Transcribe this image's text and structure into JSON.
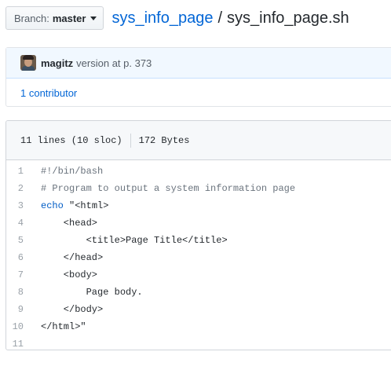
{
  "branch": {
    "prefix": "Branch:",
    "name": "master"
  },
  "breadcrumb": {
    "repo": "sys_info_page",
    "separator": "/",
    "file": "sys_info_page.sh"
  },
  "commit": {
    "author": "magitz",
    "message": "version at p. 373",
    "contributors": "1 contributor"
  },
  "file": {
    "lines_info": "11 lines (10 sloc)",
    "size": "172 Bytes"
  },
  "code_lines": [
    {
      "num": "1",
      "text": "#!/bin/bash"
    },
    {
      "num": "2",
      "text": "# Program to output a system information page"
    },
    {
      "num": "3",
      "kw": "echo",
      "text": " \"<html>"
    },
    {
      "num": "4",
      "text": "    <head>"
    },
    {
      "num": "5",
      "text": "        <title>Page Title</title>"
    },
    {
      "num": "6",
      "text": "    </head>"
    },
    {
      "num": "7",
      "text": "    <body>"
    },
    {
      "num": "8",
      "text": "        Page body."
    },
    {
      "num": "9",
      "text": "    </body>"
    },
    {
      "num": "10",
      "text": "</html>\""
    },
    {
      "num": "11",
      "text": ""
    }
  ]
}
